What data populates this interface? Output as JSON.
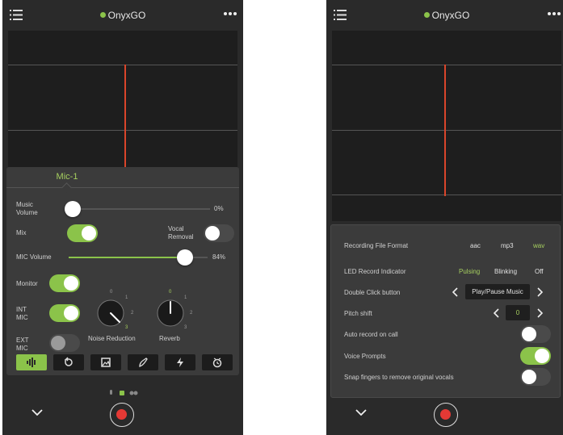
{
  "app": {
    "title": "OnyxGO",
    "status_color": "#8bc34a",
    "accent": "#8bc34a",
    "record_color": "#e53935",
    "cursor_color": "#d9452b"
  },
  "left_screen": {
    "mixer": {
      "tab_label": "Mic-1",
      "music_volume": {
        "label": "Music Volume",
        "value_text": "0%",
        "level": 0
      },
      "mix": {
        "label": "Mix",
        "on": true
      },
      "vocal_removal": {
        "label": "Vocal Removal",
        "on": false
      },
      "mic_volume": {
        "label": "MIC Volume",
        "value_text": "84%",
        "level": 0.84
      },
      "monitor": {
        "label": "Monitor",
        "on": true
      },
      "int_mic": {
        "label": "INT MIC",
        "on": true
      },
      "ext_mic": {
        "label": "EXT MIC",
        "on": false
      },
      "noise_reduction": {
        "label": "Noise Reduction",
        "ticks": [
          "0",
          "1",
          "2",
          "3"
        ],
        "value": 3
      },
      "reverb": {
        "label": "Reverb",
        "ticks": [
          "0",
          "1",
          "2",
          "3"
        ],
        "value": 0
      },
      "effects": [
        {
          "icon": "mic-levels-icon",
          "active": true
        },
        {
          "icon": "loop-icon",
          "active": false
        },
        {
          "icon": "photo-icon",
          "active": false
        },
        {
          "icon": "brush-icon",
          "active": false
        },
        {
          "icon": "bolt-icon",
          "active": false
        },
        {
          "icon": "clock-icon",
          "active": false
        }
      ]
    }
  },
  "right_screen": {
    "settings": {
      "recording_format": {
        "label": "Recording File Format",
        "options": [
          "aac",
          "mp3",
          "wav"
        ],
        "selected": "wav"
      },
      "led_indicator": {
        "label": "LED Record Indicator",
        "options": [
          "Pulsing",
          "Blinking",
          "Off"
        ],
        "selected": "Pulsing"
      },
      "double_click": {
        "label": "Double Click button",
        "value": "Play/Pause Music"
      },
      "pitch_shift": {
        "label": "Pitch shift",
        "value": "0"
      },
      "auto_record": {
        "label": "Auto record on call",
        "on": false
      },
      "voice_prompts": {
        "label": "Voice Prompts",
        "on": true
      },
      "snap_fingers": {
        "label": "Snap fingers to remove original vocals",
        "on": false
      }
    }
  }
}
